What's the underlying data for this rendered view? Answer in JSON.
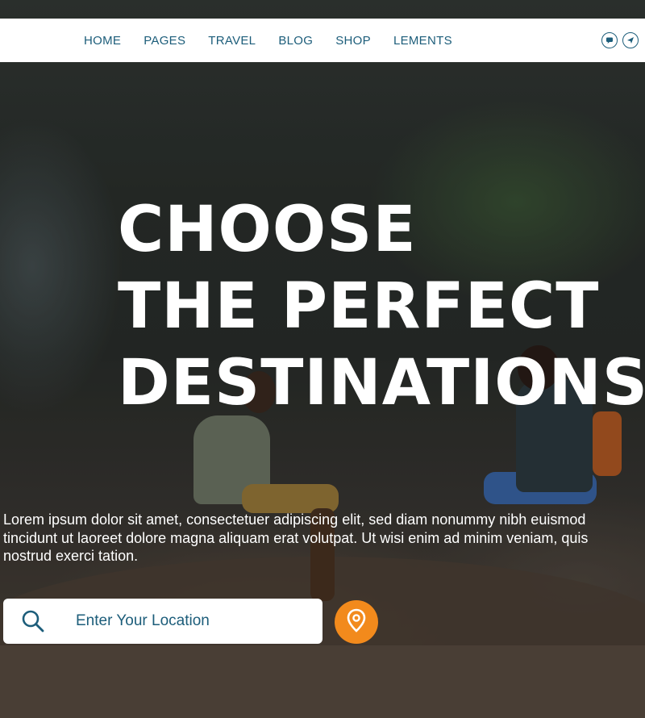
{
  "nav": {
    "items": [
      {
        "label": "HOME"
      },
      {
        "label": "PAGES"
      },
      {
        "label": "TRAVEL"
      },
      {
        "label": "BLOG"
      },
      {
        "label": "SHOP"
      },
      {
        "label": "LEMENTS"
      }
    ],
    "icons": [
      "chat-icon",
      "send-icon"
    ]
  },
  "hero": {
    "headline_lines": [
      "CHOOSE",
      "THE PERFECT",
      "DESTINATIONS."
    ],
    "lead": "Lorem ipsum dolor sit amet, consectetuer adipiscing elit, sed diam nonummy nibh euismod tincidunt ut laoreet dolore magna aliquam erat volutpat. Ut wisi enim ad minim veniam, quis nostrud exerci tation."
  },
  "search": {
    "placeholder": "Enter Your Location",
    "value": "",
    "icon": "search-icon",
    "button_icon": "location-pin-icon"
  },
  "colors": {
    "accent": "#1c5d7a",
    "button": "#f28a1c",
    "headline": "#ffffff"
  }
}
